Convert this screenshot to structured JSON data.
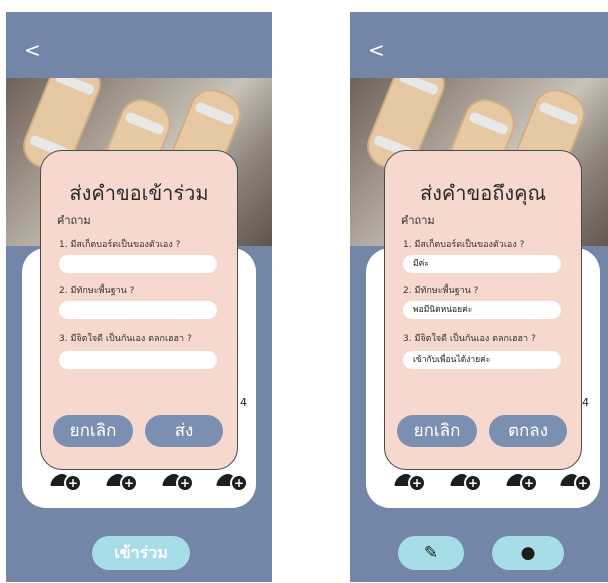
{
  "colors": {
    "header": "#7386a8",
    "modal": "#f6d8ce",
    "button": "#7a8fb2",
    "bottom_button": "#a6dde6"
  },
  "left": {
    "back": "<",
    "modal": {
      "title": "ส่งคำขอเข้าร่วม",
      "heading": "คำถาม",
      "questions": [
        {
          "label": "1. มีสเก็ตบอร์ดเป็นของตัวเอง ?",
          "answer": ""
        },
        {
          "label": "2. มีทักษะพื้นฐาน ?",
          "answer": ""
        },
        {
          "label": "3. มีจิตใจดี เป็นกันเอง ตลกเฮฮา ?",
          "answer": ""
        }
      ],
      "cancel": "ยกเลิก",
      "submit": "ส่ง"
    },
    "side_number": "4",
    "bottom_button": "เข้าร่วม",
    "icons": {
      "back": "chevron-left-icon",
      "add_user": "add-user-icon"
    }
  },
  "right": {
    "back": "<",
    "modal": {
      "title": "ส่งคำขอถึงคุณ",
      "heading": "คำถาม",
      "questions": [
        {
          "label": "1. มีสเก็ตบอร์ดเป็นของตัวเอง ?",
          "answer": "มีค่ะ"
        },
        {
          "label": "2. มีทักษะพื้นฐาน ?",
          "answer": "พอมีนิดหน่อยค่ะ"
        },
        {
          "label": "3. มีจิตใจดี เป็นกันเอง ตลกเฮฮา ?",
          "answer": "เข้ากับเพื่อนได้ง่ายค่ะ"
        }
      ],
      "cancel": "ยกเลิก",
      "submit": "ตกลง"
    },
    "side_number": "4",
    "icons": {
      "back": "chevron-left-icon",
      "edit": "pencil-icon",
      "chat": "chat-bubble-icon",
      "add_user": "add-user-icon"
    }
  }
}
